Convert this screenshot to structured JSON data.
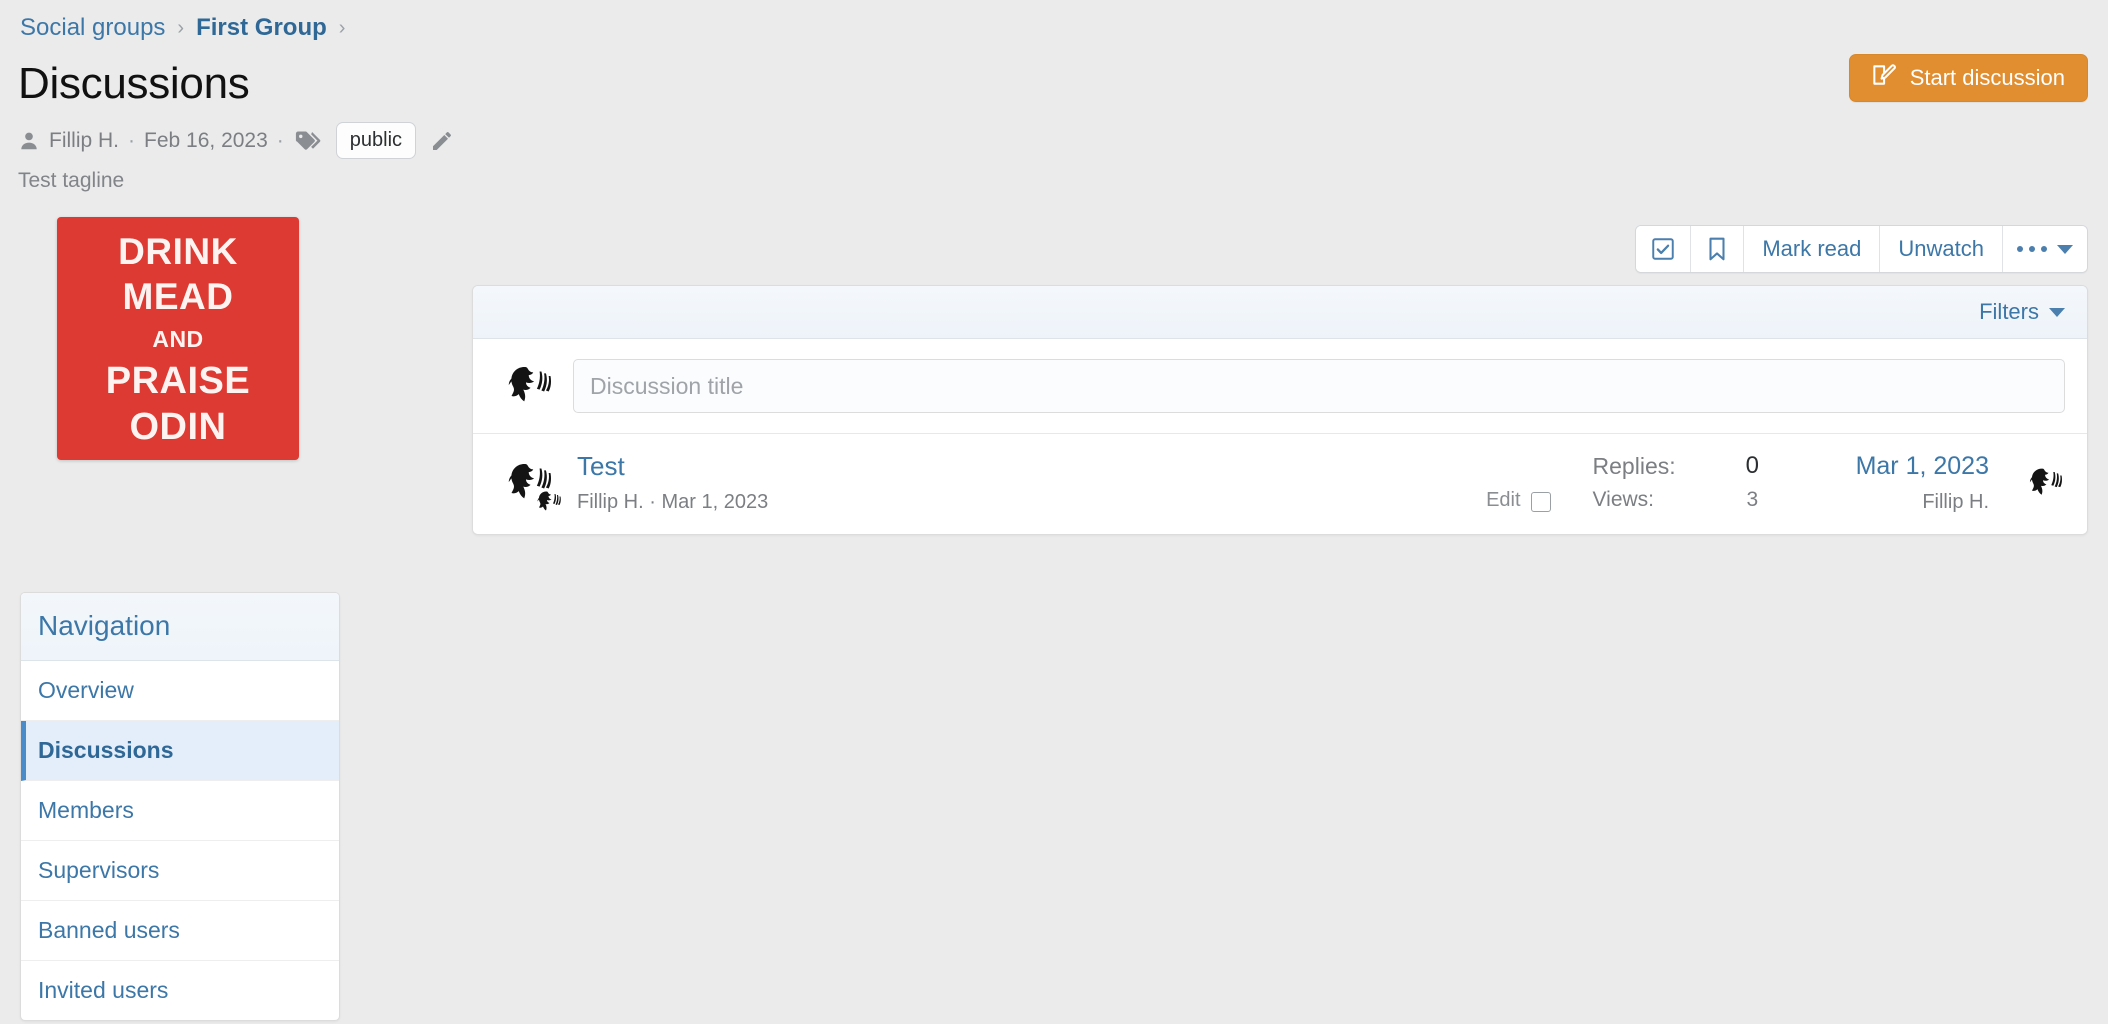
{
  "breadcrumb": {
    "items": [
      {
        "label": "Social groups",
        "current": false
      },
      {
        "label": "First Group",
        "current": true
      }
    ],
    "separator": "›"
  },
  "header": {
    "title": "Discussions",
    "author": "Fillip H.",
    "date": "Feb 16, 2023",
    "separator_dot": "·",
    "tag_badge": "public",
    "tagline": "Test tagline",
    "start_button": "Start discussion"
  },
  "poster": {
    "line1": "DRINK",
    "line2": "MEAD",
    "line3": "AND",
    "line4": "PRAISE",
    "line5": "ODIN",
    "background_color": "#dc3a32",
    "text_color": "#fdf4f2"
  },
  "navigation": {
    "heading": "Navigation",
    "items": [
      {
        "label": "Overview",
        "active": false
      },
      {
        "label": "Discussions",
        "active": true
      },
      {
        "label": "Members",
        "active": false
      },
      {
        "label": "Supervisors",
        "active": false
      },
      {
        "label": "Banned users",
        "active": false
      },
      {
        "label": "Invited users",
        "active": false
      }
    ]
  },
  "toolbar": {
    "select_all_title": "select-all",
    "bookmark_title": "bookmark",
    "mark_read": "Mark read",
    "unwatch": "Unwatch",
    "more": "…"
  },
  "list": {
    "filters_label": "Filters",
    "compose_placeholder": "Discussion title",
    "compose_value": "",
    "rows": [
      {
        "title": "Test",
        "author": "Fillip H.",
        "date": "Mar 1, 2023",
        "separator_dot": "·",
        "edit_label": "Edit",
        "edit_checked": false,
        "replies_label": "Replies:",
        "replies_value": "0",
        "views_label": "Views:",
        "views_value": "3",
        "last_post_date": "Mar 1, 2023",
        "last_post_user": "Fillip H."
      }
    ]
  },
  "colors": {
    "page_background": "#ebebeb",
    "link_blue": "#3c77a8",
    "accent_orange": "#e08e30",
    "active_nav_background": "#e3eefa"
  }
}
